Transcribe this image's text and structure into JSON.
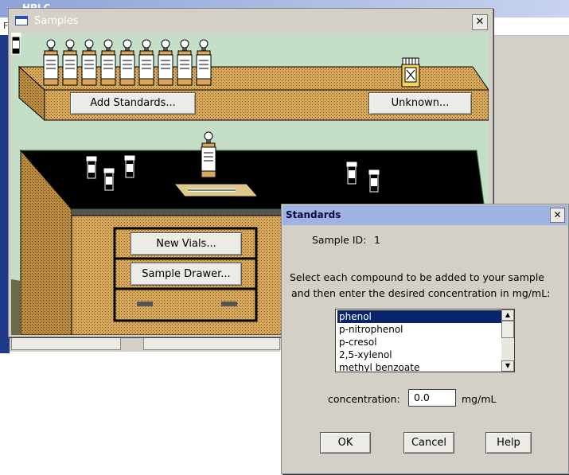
{
  "background_app": {
    "title": "HPLC",
    "menu_first": "F"
  },
  "samples_window": {
    "title": "Samples",
    "close_label": "✕",
    "buttons": {
      "add_standards": "Add Standards...",
      "unknown": "Unknown...",
      "new_vials": "New Vials...",
      "sample_drawer": "Sample Drawer..."
    }
  },
  "standards_dialog": {
    "title": "Standards",
    "close_label": "✕",
    "sample_id_label": "Sample ID:",
    "sample_id_value": "1",
    "instructions_line1": "Select each compound to be added to your sample",
    "instructions_line2": "and then enter the desired concentration in mg/mL:",
    "compounds": [
      "phenol",
      "p-nitrophenol",
      "p-cresol",
      "2,5-xylenol",
      "methyl benzoate"
    ],
    "selected_compound": "phenol",
    "concentration_label": "concentration:",
    "concentration_value": "0.0",
    "concentration_unit": "mg/mL",
    "ok_label": "OK",
    "cancel_label": "Cancel",
    "help_label": "Help"
  },
  "colors": {
    "lab_background": "#c4dec8",
    "bench_tan": "#d7a85b",
    "bench_top": "#000000",
    "selection": "#0a246a"
  }
}
